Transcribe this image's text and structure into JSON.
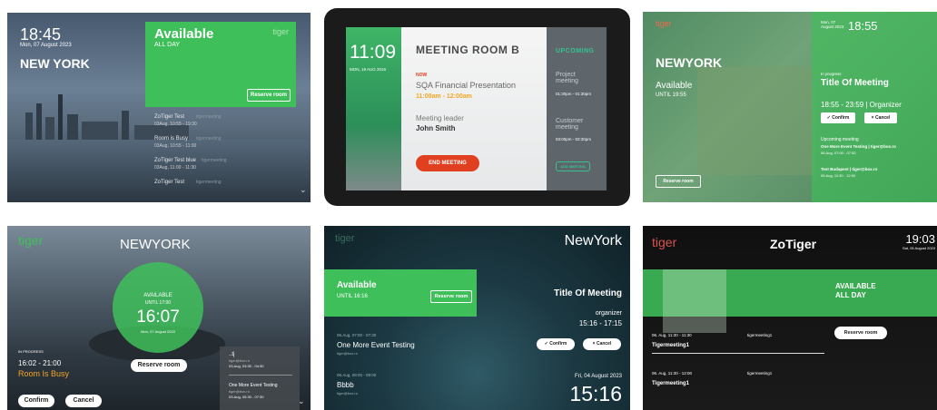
{
  "colors": {
    "green": "#3fbf5a",
    "red": "#e0401f",
    "orange": "#f5a623",
    "teal": "#34c38f"
  },
  "t1": {
    "time": "18:45",
    "date": "Mon, 07 August 2023",
    "city": "NEW YORK",
    "status": "Available",
    "status_sub": "ALL DAY",
    "brand": "tiger",
    "reserve": "Reserve room",
    "events": [
      {
        "title": "ZoTiger Test",
        "org": "tigermeeting",
        "time": "03Aug, 10:55 - 19:30"
      },
      {
        "title": "Room is Busy",
        "org": "tigermeeting",
        "time": "03Aug, 10:55 - 11:00"
      },
      {
        "title": "ZoTiger Test blue",
        "org": "tigermeeting",
        "time": "03Aug, 11:00 - 11:30"
      },
      {
        "title": "ZoTiger Test",
        "org": "tigermeeting",
        "time": ""
      }
    ]
  },
  "t2": {
    "time": "11:09",
    "date": "MON, 19 AUG 2016",
    "room": "MEETING ROOM B",
    "now": "NOW",
    "meeting": "SQA Financial Presentation",
    "meeting_time": "11:00am - 12:00am",
    "leader_label": "Meeting leader",
    "leader": "John Smith",
    "end": "END MEETING",
    "upcoming": "UPCOMING",
    "up": [
      {
        "title": "Project meeting",
        "time": "01:30pm - 01:30pm"
      },
      {
        "title": "Customer meeting",
        "time": "03:00pm - 03:30pm"
      }
    ],
    "add": "ADD MEETING"
  },
  "t3": {
    "brand": "tiger",
    "date": "Mon, 07 August 2023",
    "time": "18:55",
    "city": "NEWYORK",
    "status": "Available",
    "until": "UNTIL 19:55",
    "progress": "In progress",
    "title": "Title Of Meeting",
    "span": "18:55 - 23:59 | Organizer",
    "confirm": "Confirm",
    "cancel": "Cancel",
    "upcoming": "Upcoming meeting",
    "events": [
      {
        "title": "One More Event Testing | tiger@box.ro",
        "time": "06.Aug, 07:00 - 07:30"
      },
      {
        "title": "Test Budapest | tiger@box.ro",
        "time": "06.Aug, 11:30 - 12:00"
      }
    ],
    "reserve": "Reserve room"
  },
  "t4": {
    "brand": "tiger",
    "city": "NEWYORK",
    "status": "AVAILABLE",
    "until": "UNTIL 17:00",
    "time": "16:07",
    "date": "Mon, 07 August 2023",
    "reserve": "Reserve room",
    "progress": "IN PROGRESS",
    "span": "16:02 - 21:00",
    "busy": "Room Is Busy",
    "confirm": "Confirm",
    "cancel": "Cancel",
    "events": [
      {
        "title": "..tj",
        "org": "tiger@box.ro",
        "time": "03.Aug, 03:30 - 04:30"
      },
      {
        "title": "One More Event Testing",
        "org": "tiger@box.ro",
        "time": "03.Aug, 05:30 - 07:30"
      }
    ]
  },
  "t5": {
    "brand": "tiger",
    "city": "NewYork",
    "status": "Available",
    "until": "UNTIL 16:16",
    "reserve": "Reserve room",
    "title": "Title Of Meeting",
    "organizer": "organizer",
    "span": "15:16 - 17:15",
    "confirm": "Confirm",
    "cancel": "Cancel",
    "date": "Fri, 04 August 2023",
    "time": "15:16",
    "events": [
      {
        "time": "06.Aug, 07:00 - 07:30",
        "title": "One More Event Testing",
        "org": "tiger@box.ro"
      },
      {
        "time": "06.Aug, 08:00 - 09:00",
        "title": "Bbbb",
        "org": "tiger@box.ro"
      }
    ]
  },
  "t6": {
    "brand": "tiger",
    "title": "ZoTiger",
    "time": "19:03",
    "date": "Sat, 05 August 2023",
    "status": "AVAILABLE",
    "status_sub": "ALL DAY",
    "reserve": "Reserve room",
    "events": [
      {
        "time": "06. Aug, 11:30 - 11:30",
        "org": "tigermeeting1",
        "title": "Tigermeeting1"
      },
      {
        "time": "06. Aug, 11:30 - 12:00",
        "org": "tigermeeting1",
        "title": "Tigermeeting1"
      }
    ]
  }
}
